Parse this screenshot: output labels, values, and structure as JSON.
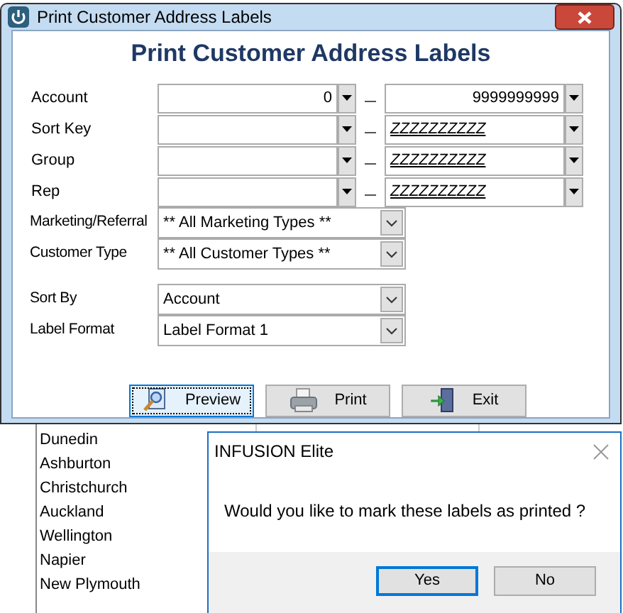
{
  "background_list": {
    "items": [
      "Dunedin",
      "Ashburton",
      "Christchurch",
      "Auckland",
      "Wellington",
      "Napier",
      "New Plymouth"
    ]
  },
  "window": {
    "title": "Print Customer Address Labels",
    "heading": "Print Customer Address Labels",
    "range_rows": [
      {
        "label": "Account",
        "kind": "number",
        "from": "0",
        "to": "9999999999"
      },
      {
        "label": "Sort Key",
        "kind": "code",
        "from": "",
        "to": "ZZZZZZZZZZ"
      },
      {
        "label": "Group",
        "kind": "code",
        "from": "",
        "to": "ZZZZZZZZZZ"
      },
      {
        "label": "Rep",
        "kind": "code",
        "from": "",
        "to": "ZZZZZZZZZZ"
      }
    ],
    "filters": [
      {
        "label": "Marketing/Referral",
        "value": "** All Marketing Types **"
      },
      {
        "label": "Customer Type",
        "value": "** All Customer Types **"
      }
    ],
    "options": [
      {
        "label": "Sort By",
        "value": "Account"
      },
      {
        "label": "Label Format",
        "value": "Label Format 1"
      }
    ],
    "buttons": [
      {
        "label": "Preview",
        "kind": "preview",
        "focused": true
      },
      {
        "label": "Print",
        "kind": "print",
        "focused": false
      },
      {
        "label": "Exit",
        "kind": "exit",
        "focused": false
      }
    ]
  },
  "dialog": {
    "title": "INFUSION Elite",
    "message": "Would you like to mark these labels as printed ?",
    "buttons": [
      {
        "label": "Yes",
        "default": true
      },
      {
        "label": "No",
        "default": false
      }
    ]
  }
}
